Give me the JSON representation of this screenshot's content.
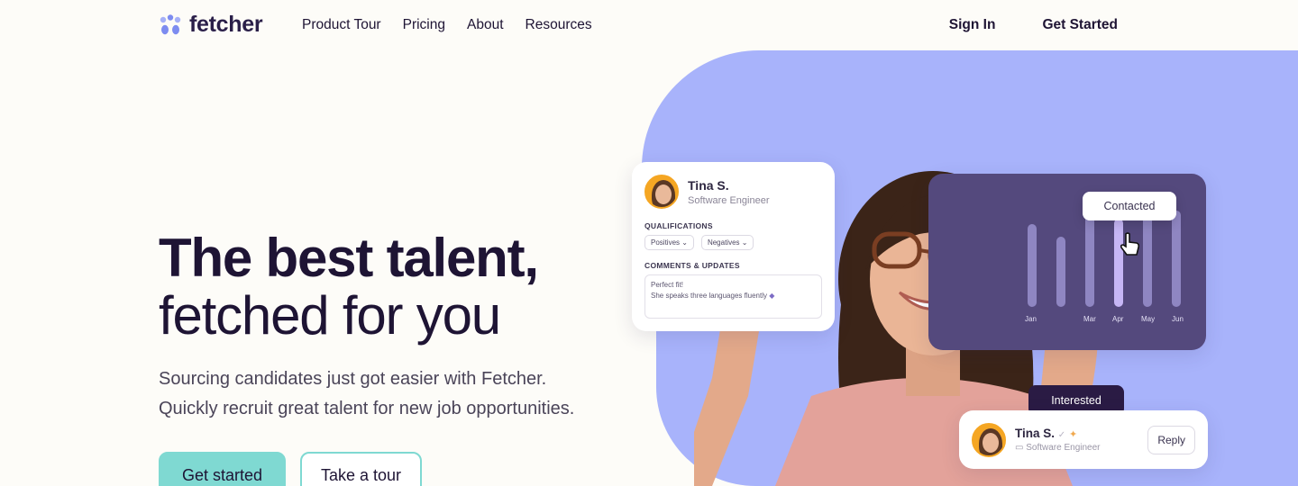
{
  "nav": {
    "logo_text": "fetcher",
    "links": [
      "Product Tour",
      "Pricing",
      "About",
      "Resources"
    ],
    "sign_in": "Sign In",
    "get_started": "Get Started"
  },
  "hero": {
    "headline_line1": "The best talent,",
    "headline_line2": "fetched for you",
    "sub_line1": "Sourcing candidates just got easier with Fetcher.",
    "sub_line2": "Quickly recruit great talent for new job opportunities.",
    "cta_primary": "Get started",
    "cta_secondary": "Take a tour"
  },
  "profile_card": {
    "name": "Tina S.",
    "role": "Software Engineer",
    "qualifications_label": "QUALIFICATIONS",
    "positives": "Positives",
    "negatives": "Negatives",
    "comments_label": "COMMENTS & UPDATES",
    "comment_line1": "Perfect fit!",
    "comment_line2": "She speaks three languages fluently"
  },
  "chart_card": {
    "months": [
      "Jan",
      "Mar",
      "Apr",
      "May",
      "Jun"
    ],
    "tooltip": "Contacted"
  },
  "status_card": {
    "badge": "Interested",
    "name": "Tina S.",
    "role": "Software Engineer",
    "reply": "Reply"
  },
  "colors": {
    "accent": "#7fd9d2",
    "blob": "#a8b3fb",
    "chart_bg": "#54497d",
    "dark": "#1e1434"
  }
}
